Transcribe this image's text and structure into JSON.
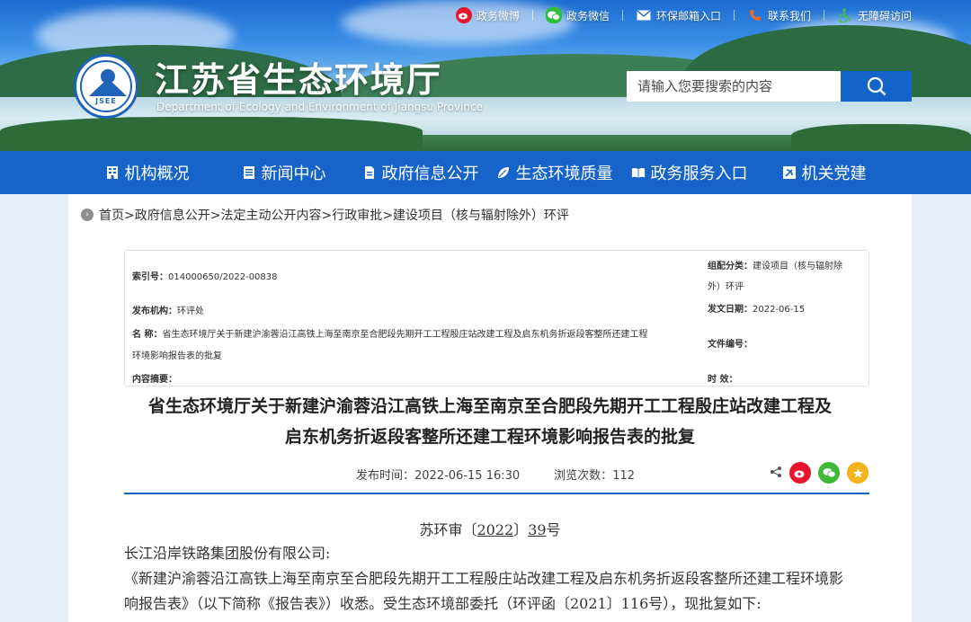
{
  "header": {
    "top_links": [
      {
        "label": "政务微博",
        "icon": "weibo-icon"
      },
      {
        "label": "政务微信",
        "icon": "wechat-icon"
      },
      {
        "label": "环保邮箱入口",
        "icon": "mail-icon"
      },
      {
        "label": "联系我们",
        "icon": "phone-icon"
      },
      {
        "label": "无障碍访问",
        "icon": "accessibility-icon"
      }
    ],
    "logo_text": "JSEE",
    "site_title": "江苏省生态环境厅",
    "site_subtitle": "Department of Ecology and Environment of Jiangsu Province",
    "search": {
      "placeholder": "请输入您要搜索的内容"
    }
  },
  "nav": {
    "items": [
      {
        "label": "机构概况",
        "icon": "building-icon"
      },
      {
        "label": "新闻中心",
        "icon": "newspaper-icon"
      },
      {
        "label": "政府信息公开",
        "icon": "document-icon"
      },
      {
        "label": "生态环境质量",
        "icon": "leaf-icon"
      },
      {
        "label": "政务服务入口",
        "icon": "book-icon"
      },
      {
        "label": "机关党建",
        "icon": "party-flag-icon"
      }
    ]
  },
  "breadcrumb": "首页>政府信息公开>法定主动公开内容>行政审批>建设项目（核与辐射除外）环评",
  "meta": {
    "index_label": "索引号：",
    "index_value": "014000650/2022-00838",
    "category_label": "组配分类：",
    "category_value_1": "建设项目（核与辐射除",
    "category_value_2": "外）环评",
    "publisher_label": "发布机构：",
    "publisher_value": "环评处",
    "date_label": "发文日期：",
    "date_value": "2022-06-15",
    "name_label": "名  称：",
    "name_value_1": "省生态环境厅关于新建沪渝蓉沿江高铁上海至南京至合肥段先期开工工程殷庄站改建工程及启东机务折返段客整所还建工程",
    "name_value_2": "环境影响报告表的批复",
    "docnum_label": "文件编号：",
    "summary_label": "内容摘要：",
    "validity_label": "时  效："
  },
  "article": {
    "title_line1": "省生态环境厅关于新建沪渝蓉沿江高铁上海至南京至合肥段先期开工工程殷庄站改建工程及",
    "title_line2": "启东机务折返段客整所还建工程环境影响报告表的批复",
    "publish_time_label": "发布时间：",
    "publish_time": "2022-06-15 16:30",
    "views_label": "浏览次数：",
    "views": "112",
    "doc_prefix": "苏环审〔",
    "doc_year": "2022",
    "doc_mid": "〕",
    "doc_num": "39",
    "doc_suffix": "号",
    "recipient": "长江沿岸铁路集团股份有限公司:",
    "body_line1": "《新建沪渝蓉沿江高铁上海至南京至合肥段先期开工工程殷庄站改建工程及启东机务折返段客整所还建工程环境影",
    "body_line2": "响报告表》（以下简称《报告表》）收悉。受生态环境部委托（环评函〔2021〕116号），现批复如下:"
  },
  "share": [
    {
      "icon": "weibo-share-icon",
      "color": "#e6162d"
    },
    {
      "icon": "wechat-share-icon",
      "color": "#3fb838"
    },
    {
      "icon": "favorite-star-icon",
      "color": "#f4b21b"
    }
  ],
  "colors": {
    "nav_blue": "#1664c9",
    "search_button": "#1463c9"
  }
}
